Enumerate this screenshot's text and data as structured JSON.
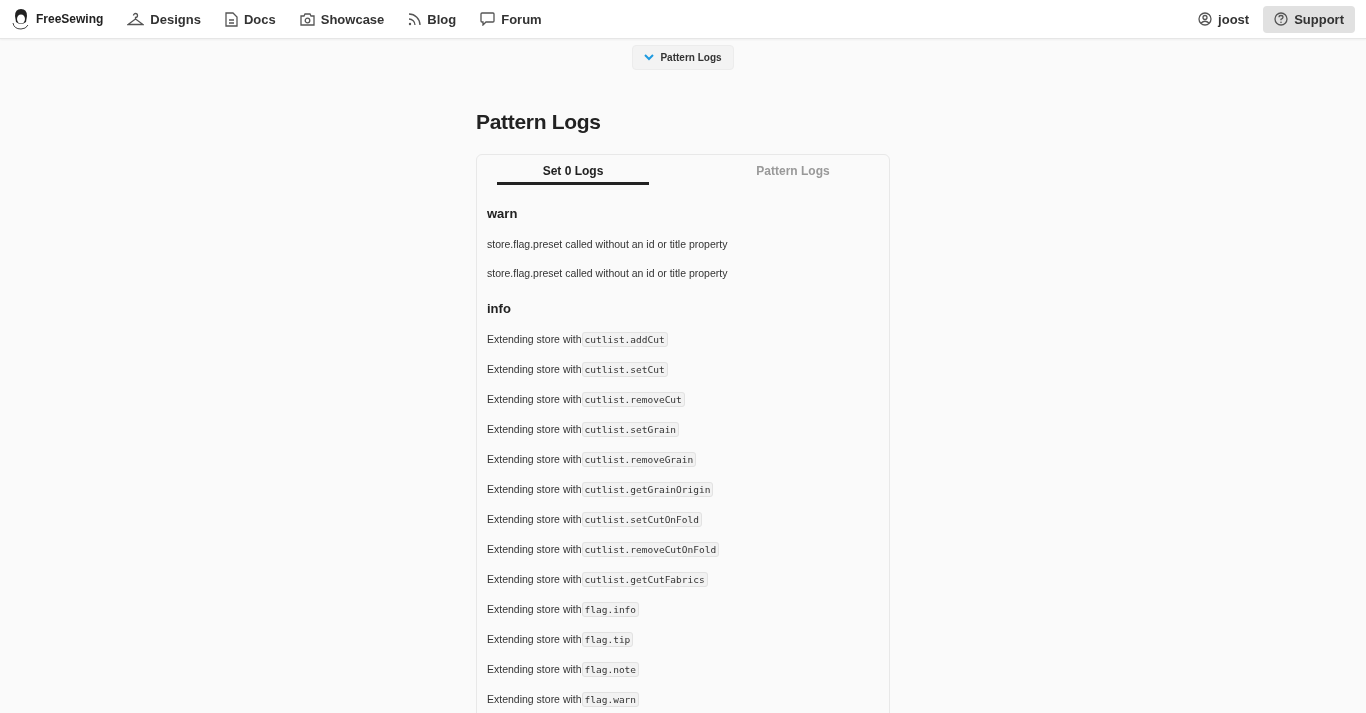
{
  "header": {
    "brand": "FreeSewing",
    "nav": [
      {
        "kind": "hanger",
        "label": "Designs"
      },
      {
        "kind": "doc",
        "label": "Docs"
      },
      {
        "kind": "camera",
        "label": "Showcase"
      },
      {
        "kind": "rss",
        "label": "Blog"
      },
      {
        "kind": "chat",
        "label": "Forum"
      }
    ],
    "user": "joost",
    "support": "Support"
  },
  "dropdown": {
    "label": "Pattern Logs",
    "expanded": true
  },
  "title": "Pattern Logs",
  "tabs": [
    {
      "label": "Set 0 Logs",
      "selected": true
    },
    {
      "label": "Pattern Logs",
      "selected": false
    }
  ],
  "sections": [
    {
      "heading": "warn",
      "entries": [
        {
          "text": "store.flag.preset called without an id or title property"
        },
        {
          "text": "store.flag.preset called without an id or title property"
        }
      ]
    },
    {
      "heading": "info",
      "entries": [
        {
          "text": "Extending store with",
          "code": "cutlist.addCut"
        },
        {
          "text": "Extending store with",
          "code": "cutlist.setCut"
        },
        {
          "text": "Extending store with",
          "code": "cutlist.removeCut"
        },
        {
          "text": "Extending store with",
          "code": "cutlist.setGrain"
        },
        {
          "text": "Extending store with",
          "code": "cutlist.removeGrain"
        },
        {
          "text": "Extending store with",
          "code": "cutlist.getGrainOrigin"
        },
        {
          "text": "Extending store with",
          "code": "cutlist.setCutOnFold"
        },
        {
          "text": "Extending store with",
          "code": "cutlist.removeCutOnFold"
        },
        {
          "text": "Extending store with",
          "code": "cutlist.getCutFabrics"
        },
        {
          "text": "Extending store with",
          "code": "flag.info"
        },
        {
          "text": "Extending store with",
          "code": "flag.tip"
        },
        {
          "text": "Extending store with",
          "code": "flag.note"
        },
        {
          "text": "Extending store with",
          "code": "flag.warn"
        }
      ]
    }
  ]
}
